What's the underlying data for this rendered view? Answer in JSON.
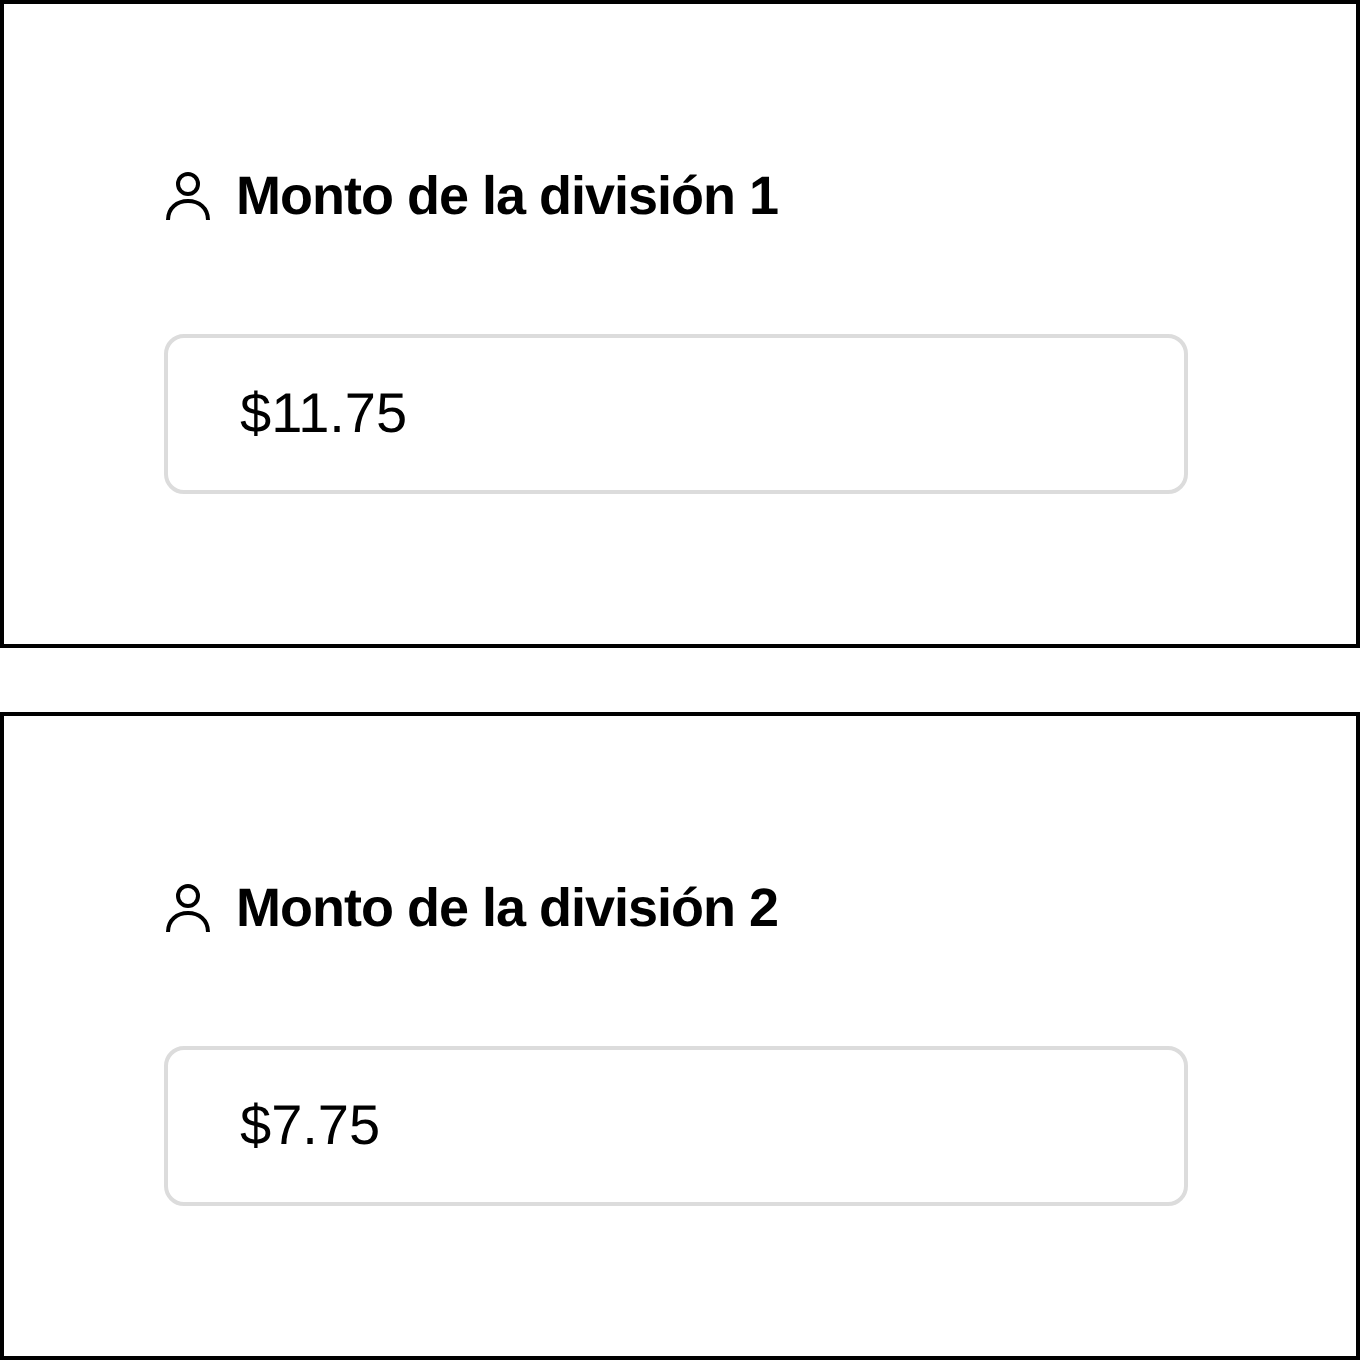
{
  "splits": [
    {
      "label": "Monto de la división 1",
      "value": "$11.75"
    },
    {
      "label": "Monto de la división 2",
      "value": "$7.75"
    }
  ]
}
